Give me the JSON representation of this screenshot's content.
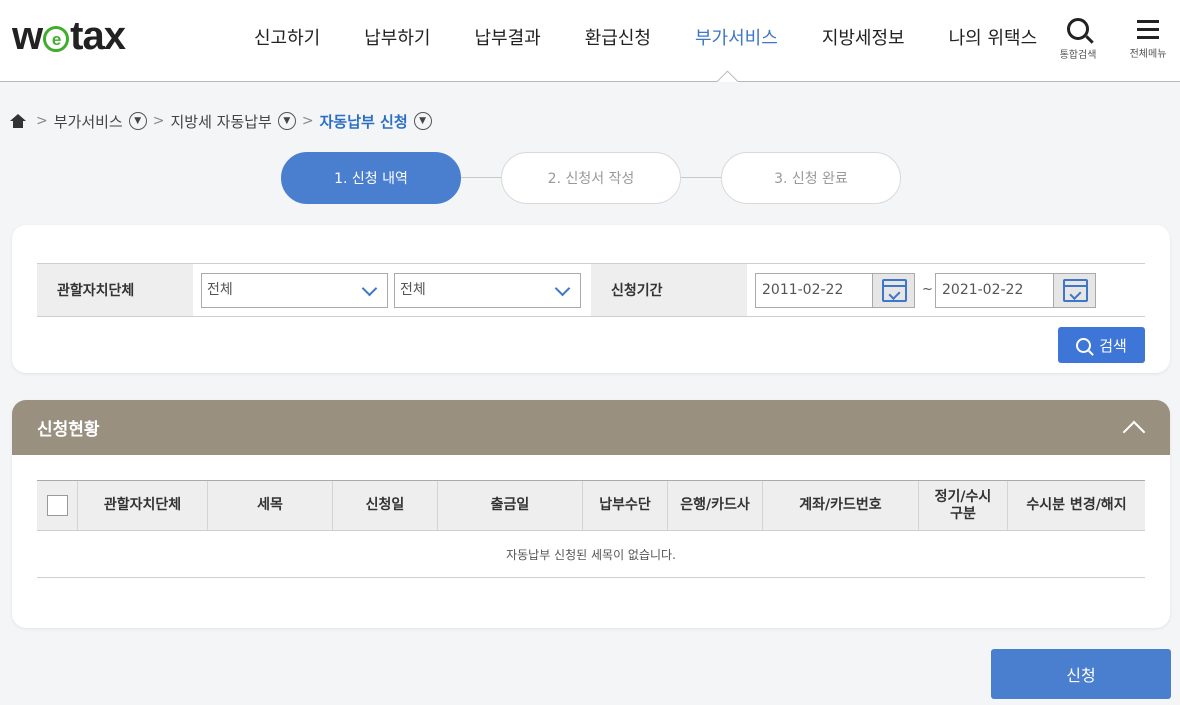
{
  "header": {
    "logo": {
      "pre": "w",
      "e": "e",
      "post": "tax"
    },
    "nav": [
      {
        "label": "신고하기"
      },
      {
        "label": "납부하기"
      },
      {
        "label": "납부결과"
      },
      {
        "label": "환급신청"
      },
      {
        "label": "부가서비스",
        "active": true
      },
      {
        "label": "지방세정보"
      },
      {
        "label": "나의 위택스"
      }
    ],
    "search_label": "통합검색",
    "menu_label": "전체메뉴"
  },
  "breadcrumb": {
    "items": [
      "부가서비스",
      "지방세 자동납부",
      "자동납부 신청"
    ]
  },
  "steps": [
    "1. 신청 내역",
    "2. 신청서 작성",
    "3. 신청 완료"
  ],
  "filter": {
    "region_label": "관할자치단체",
    "select1": "전체",
    "select2": "전체",
    "period_label": "신청기간",
    "date_from": "2011-02-22",
    "date_to": "2021-02-22",
    "tilde": "~",
    "search_button": "검색"
  },
  "status": {
    "title": "신청현황",
    "columns": [
      "관할자치단체",
      "세목",
      "신청일",
      "출금일",
      "납부수단",
      "은행/카드사",
      "계좌/카드번호",
      "정기/수시\n구분",
      "수시분 변경/해지"
    ],
    "empty_message": "자동납부 신청된 세목이 없습니다."
  },
  "submit_button": "신청",
  "colors": {
    "accent": "#3e76c9",
    "step_active": "#4a7fd0",
    "status_header": "#9a9080",
    "logo_green": "#3fae2a"
  }
}
